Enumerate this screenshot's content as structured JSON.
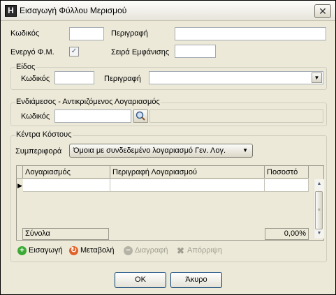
{
  "window": {
    "title": "Εισαγωγή Φύλλου Μερισμού",
    "app_icon_letter": "H",
    "close_glyph": "✕"
  },
  "header": {
    "code_label": "Κωδικός",
    "code_value": "",
    "description_label": "Περιγραφή",
    "description_value": "",
    "active_label": "Ενεργό Φ.Μ.",
    "active_checked": true,
    "order_label": "Σειρά Εμφάνισης",
    "order_value": ""
  },
  "type_group": {
    "title": "Είδος",
    "code_label": "Κωδικός",
    "description_label": "Περιγραφή",
    "description_value": ""
  },
  "account_group": {
    "title": "Ενδιάμεσος - Αντικριζόμενος Λογαριασμός",
    "code_label": "Κωδικός",
    "lookup_icon": "search-icon"
  },
  "cost_center_group": {
    "title": "Κέντρα Κόστους",
    "behavior_label": "Συμπεριφορά",
    "behavior_value": "Όμοια με συνδεδεμένο λογαριασμό Γεν. Λογ."
  },
  "table": {
    "columns": [
      "Λογαριασμός",
      "Περιγραφή Λογαριασμού",
      "Ποσοστό"
    ],
    "rows": [
      [
        "",
        "",
        ""
      ]
    ],
    "totals_label": "Σύνολα",
    "totals_value": "0,00%"
  },
  "toolbar": {
    "insert_label": "Εισαγωγή",
    "edit_label": "Μεταβολή",
    "delete_label": "Διαγραφή",
    "reject_label": "Απόρριψη"
  },
  "buttons": {
    "ok_label": "OK",
    "cancel_label": "Άκυρο"
  },
  "colors": {
    "window_bg": "#ECE9D8",
    "insert_icon": "#3BAA35",
    "edit_icon": "#E0622B",
    "disabled_text": "#A19F91"
  }
}
